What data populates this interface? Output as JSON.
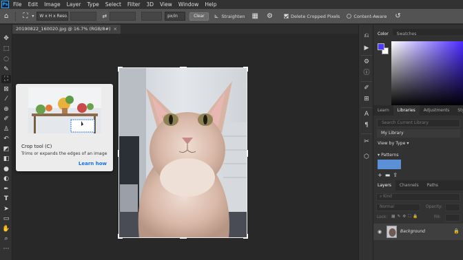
{
  "app": {
    "logo": "Ps"
  },
  "menu": [
    "File",
    "Edit",
    "Image",
    "Layer",
    "Type",
    "Select",
    "Filter",
    "3D",
    "View",
    "Window",
    "Help"
  ],
  "options": {
    "ratio_value": "W x H x Reso...",
    "unit_value": "px/in",
    "clear_label": "Clear",
    "straighten_label": "Straighten",
    "delete_cropped_label": "Delete Cropped Pixels",
    "delete_cropped_checked": true,
    "content_aware_label": "Content-Aware",
    "content_aware_checked": false
  },
  "document": {
    "tab_title": "20190822_160020.jpg @ 16.7% (RGB/8#)",
    "close_glyph": "×"
  },
  "tooltip": {
    "title": "Crop tool (C)",
    "description": "Trims or expands the edges of an image",
    "link": "Learn how"
  },
  "color_panel": {
    "tabs": [
      "Color",
      "Swatches"
    ],
    "foreground": "#4b3cff",
    "background": "#ffffff"
  },
  "libraries_panel": {
    "tabs": [
      "Learn",
      "Libraries",
      "Adjustments",
      "Styles"
    ],
    "search_placeholder": "Search Current Library",
    "library_name": "My Library",
    "view_by": "View by Type",
    "section": "Patterns"
  },
  "layers_panel": {
    "tabs": [
      "Layers",
      "Channels",
      "Paths"
    ],
    "kind_placeholder": "Kind",
    "blend_mode": "Normal",
    "opacity_label": "Opacity:",
    "lock_label": "Lock:",
    "fill_label": "Fill:",
    "layer_name": "Background"
  },
  "icons": {
    "tools": [
      "move-icon",
      "marquee-icon",
      "lasso-icon",
      "quick-select-icon",
      "crop-icon",
      "frame-icon",
      "eyedropper-icon",
      "healing-icon",
      "brush-icon",
      "stamp-icon",
      "history-brush-icon",
      "eraser-icon",
      "gradient-icon",
      "blur-icon",
      "dodge-icon",
      "pen-icon",
      "type-icon",
      "path-select-icon",
      "shape-icon",
      "hand-icon",
      "zoom-icon"
    ]
  }
}
